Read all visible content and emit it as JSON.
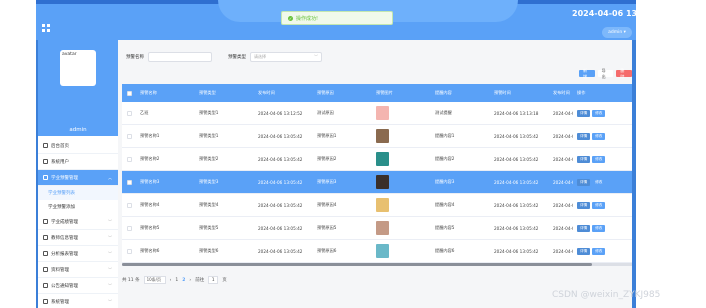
{
  "toast": {
    "text": "操作成功!"
  },
  "header": {
    "datetime": "2024-04-06 13:13:08",
    "user_button": "admin"
  },
  "sidebar": {
    "avatar_alt": "avatar",
    "username": "admin",
    "items": [
      {
        "label": "后台首页",
        "icon": "home-icon"
      },
      {
        "label": "系统用户",
        "icon": "monitor-icon"
      },
      {
        "label": "学业预警管理",
        "icon": "warning-icon"
      },
      {
        "label": "学业成绩管理",
        "icon": "tag-icon"
      },
      {
        "label": "教师信息管理",
        "icon": "settings-icon"
      },
      {
        "label": "分析报表管理",
        "icon": "chart-icon"
      },
      {
        "label": "资料管理",
        "icon": "doc-icon"
      },
      {
        "label": "公告通知管理",
        "icon": "bell-icon"
      },
      {
        "label": "系统管理",
        "icon": "system-icon"
      }
    ],
    "subitems": [
      "学业预警列表",
      "学业预警添加"
    ]
  },
  "search": {
    "label1": "预警名称",
    "label2": "预警类型",
    "select_placeholder": "请选择"
  },
  "actions": {
    "add": "新增",
    "export": "导出",
    "delete": "删除"
  },
  "table": {
    "headers": [
      "预警名称",
      "预警类型",
      "发布时间",
      "预警原因",
      "预警图片",
      "提醒内容",
      "预警时间",
      "发布时间",
      "操作"
    ],
    "rows": [
      {
        "c1": "乙班",
        "c2": "预警类型1",
        "c3": "2024-04-06 13:12:52",
        "c4": "测试原因",
        "thumb": "#f4b5b0",
        "c6": "测试提醒",
        "c7": "2024-04-06 13:13:18",
        "c8": "2024-04-06"
      },
      {
        "c1": "预警名称1",
        "c2": "预警类型1",
        "c3": "2024-04-06 13:05:42",
        "c4": "预警原因1",
        "thumb": "#8a6a4f",
        "c6": "提醒内容1",
        "c7": "2024-04-06 13:05:42",
        "c8": "2024-04-06"
      },
      {
        "c1": "预警名称2",
        "c2": "预警类型2",
        "c3": "2024-04-06 13:05:42",
        "c4": "预警原因2",
        "thumb": "#2a8f8a",
        "c6": "提醒内容2",
        "c7": "2024-04-06 13:05:42",
        "c8": "2024-04-06"
      },
      {
        "c1": "预警名称3",
        "c2": "预警类型3",
        "c3": "2024-04-06 13:05:42",
        "c4": "预警原因3",
        "thumb": "#3a2f2a",
        "c6": "提醒内容3",
        "c7": "2024-04-06 13:05:42",
        "c8": "2024-04-06"
      },
      {
        "c1": "预警名称4",
        "c2": "预警类型4",
        "c3": "2024-04-06 13:05:42",
        "c4": "预警原因4",
        "thumb": "#e8c070",
        "c6": "提醒内容4",
        "c7": "2024-04-06 13:05:42",
        "c8": "2024-04-06"
      },
      {
        "c1": "预警名称5",
        "c2": "预警类型5",
        "c3": "2024-04-06 13:05:42",
        "c4": "预警原因5",
        "thumb": "#c49a86",
        "c6": "提醒内容5",
        "c7": "2024-04-06 13:05:42",
        "c8": "2024-04-06"
      },
      {
        "c1": "预警名称6",
        "c2": "预警类型6",
        "c3": "2024-04-06 13:05:42",
        "c4": "预警原因6",
        "thumb": "#6ab8c8",
        "c6": "提醒内容6",
        "c7": "2024-04-06 13:05:42",
        "c8": "2024-04-06"
      }
    ],
    "selected_row": 3,
    "row_buttons": {
      "detail": "详情",
      "edit": "修改"
    }
  },
  "pager": {
    "total": "共 11 条",
    "page_size": "10条/页",
    "pages": [
      "1",
      "2"
    ],
    "current": "2",
    "goto": "前往",
    "goto_value": "1",
    "page_suffix": "页"
  },
  "watermark": "CSDN @weixin_ZYKJ985",
  "colors": {
    "primary": "#5aa1f7",
    "danger": "#f56c6c",
    "success": "#67c23a"
  }
}
